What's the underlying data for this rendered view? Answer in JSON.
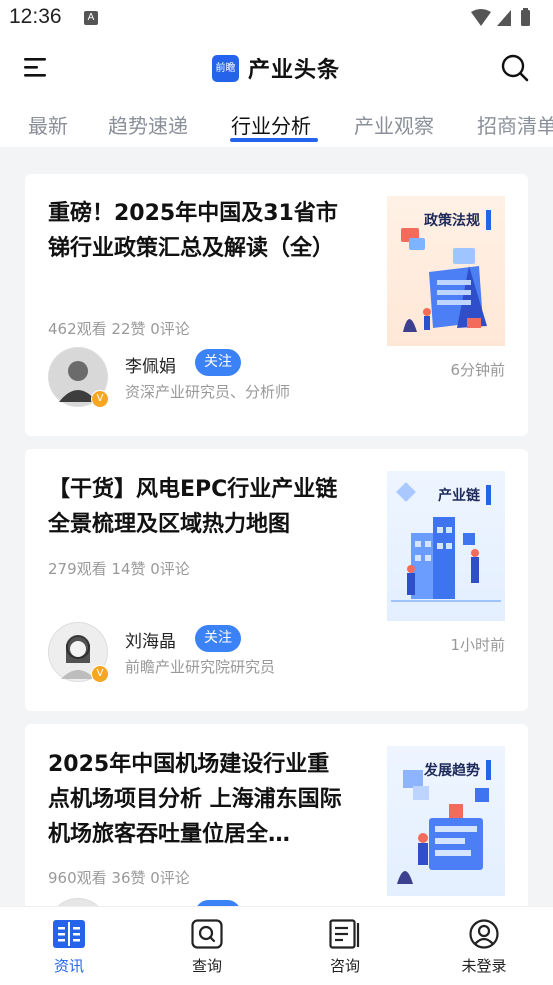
{
  "status_bar": {
    "time": "12:36",
    "notif_letter": "A"
  },
  "header": {
    "logo_text": "前瞻",
    "title": "产业头条"
  },
  "tabs": [
    {
      "label": "最新",
      "active": false
    },
    {
      "label": "趋势速递",
      "active": false
    },
    {
      "label": "行业分析",
      "active": true
    },
    {
      "label": "产业观察",
      "active": false
    },
    {
      "label": "招商清单",
      "active": false
    }
  ],
  "articles": [
    {
      "title": "重磅！2025年中国及31省市锑行业政策汇总及解读（全）",
      "stats": "462观看 22赞 0评论",
      "author": "李佩娟",
      "follow": "关注",
      "author_desc": "资深产业研究员、分析师",
      "time": "6分钟前",
      "thumb_label": "政策法规",
      "thumb_icon": "policy-illustration-icon"
    },
    {
      "title": "【干货】风电EPC行业产业链全景梳理及区域热力地图",
      "stats": "279观看 14赞 0评论",
      "author": "刘海晶",
      "follow": "关注",
      "author_desc": "前瞻产业研究院研究员",
      "time": "1小时前",
      "thumb_label": "产业链",
      "thumb_icon": "industry-chain-illustration-icon"
    },
    {
      "title": "2025年中国机场建设行业重点机场项目分析 上海浦东国际机场旅客吞吐量位居全…",
      "stats": "960观看 36赞 0评论",
      "thumb_label": "发展趋势",
      "thumb_icon": "trend-illustration-icon"
    }
  ],
  "bottom_nav": [
    {
      "label": "资讯",
      "icon": "news-icon",
      "active": true
    },
    {
      "label": "查询",
      "icon": "query-icon",
      "active": false
    },
    {
      "label": "咨询",
      "icon": "consult-icon",
      "active": false
    },
    {
      "label": "未登录",
      "icon": "user-icon",
      "active": false
    }
  ],
  "colors": {
    "accent": "#2563eb",
    "follow": "#3b82f6",
    "muted": "#999999"
  }
}
